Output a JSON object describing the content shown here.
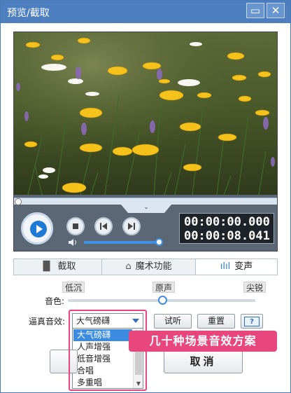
{
  "window": {
    "title": "预览/截取",
    "minimize_glyph": "▭",
    "close_glyph": "✕"
  },
  "player": {
    "current_time": "00:00:00.000",
    "total_time": "00:00:08.041",
    "progress_fraction": 0.0,
    "volume_fraction": 1.0,
    "expand_glyph": "⌄"
  },
  "tabs": [
    {
      "label": "截取",
      "icon": "film-cut-icon"
    },
    {
      "label": "魔术功能",
      "icon": "magic-hat-icon"
    },
    {
      "label": "变声",
      "icon": "soundwave-icon"
    }
  ],
  "voice": {
    "marks": {
      "low": "低沉",
      "mid": "原声",
      "high": "尖锐"
    },
    "tone_label": "音色:",
    "tone_fraction": 0.5,
    "effect_label": "逼真音效:",
    "selected": "大气磅礴",
    "options": [
      "大气磅礴",
      "人声增强",
      "低音增强",
      "合唱",
      "多重唱"
    ],
    "audition_label": "试听",
    "reset_label": "重置",
    "help_label": "?"
  },
  "footer": {
    "ok_label": "",
    "cancel_label": "取消"
  },
  "annotation": {
    "text": "几十种场景音效方案"
  },
  "colors": {
    "accent": "#4d7fc0",
    "highlight": "#e8477e",
    "select": "#3b8be0"
  }
}
